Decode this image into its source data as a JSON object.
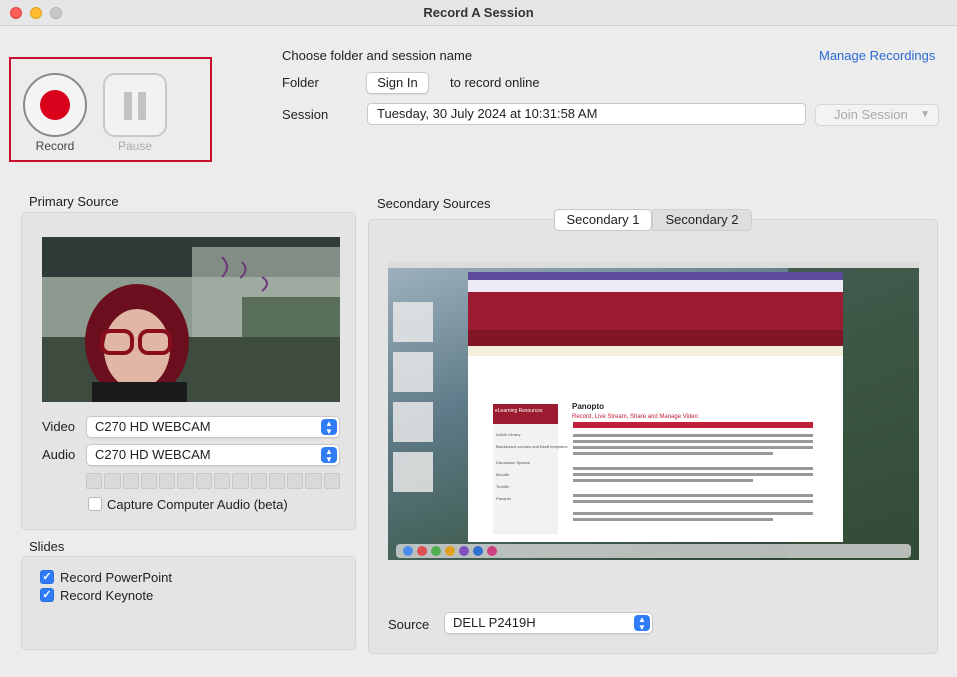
{
  "window": {
    "title": "Record A Session"
  },
  "controls": {
    "record_label": "Record",
    "pause_label": "Pause"
  },
  "session": {
    "heading": "Choose folder and session name",
    "manage_link": "Manage Recordings",
    "folder_label": "Folder",
    "sign_in_label": "Sign In",
    "online_hint": "to record online",
    "session_label": "Session",
    "session_name": "Tuesday, 30 July 2024 at 10:31:58 AM",
    "join_label": "Join Session"
  },
  "primary": {
    "title": "Primary Source",
    "video_label": "Video",
    "video_device": "C270 HD WEBCAM",
    "audio_label": "Audio",
    "audio_device": "C270 HD WEBCAM",
    "capture_audio_label": "Capture Computer Audio (beta)",
    "capture_audio_checked": false,
    "audio_level": 0
  },
  "slides": {
    "title": "Slides",
    "items": [
      {
        "label": "Record PowerPoint",
        "checked": true
      },
      {
        "label": "Record Keynote",
        "checked": true
      }
    ]
  },
  "secondary": {
    "title": "Secondary Sources",
    "tabs": [
      {
        "label": "Secondary 1",
        "active": true
      },
      {
        "label": "Secondary 2",
        "active": false
      }
    ],
    "source_label": "Source",
    "source_device": "DELL P2419H"
  },
  "colors": {
    "record_red": "#d9001b",
    "highlight_border": "#c8102e",
    "link_blue": "#2b6ad3",
    "checkbox_blue": "#2f7cf6",
    "page_maroon": "#9b1b30"
  },
  "preview_page": {
    "page_title": "Panopto",
    "heading": "Record, Live Stream, Share and Manage Video",
    "sidebar_title": "eLearning Resources",
    "sidebar_items": [
      "Article Library",
      "Blackboard courses and Bsoft templates",
      "Discussion Spaces",
      "Moodle",
      "Turnitin",
      "Panopto"
    ]
  }
}
